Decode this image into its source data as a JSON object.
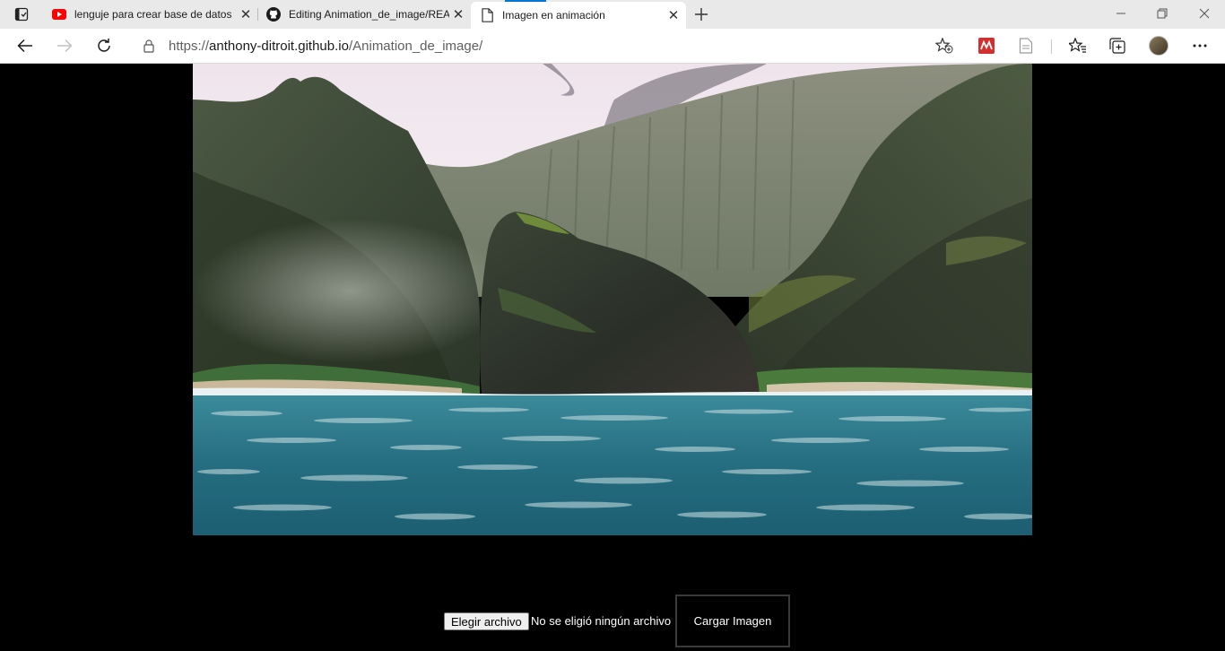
{
  "browser": {
    "tabs": [
      {
        "title": "lenguje para crear base de datos",
        "icon": "youtube-icon"
      },
      {
        "title": "Editing Animation_de_image/README",
        "icon": "github-icon"
      },
      {
        "title": "Imagen en animación",
        "icon": "page-icon",
        "active": true
      }
    ],
    "url_scheme": "https://",
    "url_host": "anthony-ditroit.github.io",
    "url_path": "/Animation_de_image/"
  },
  "page": {
    "image_alt": "Imagen en animación",
    "file_input": {
      "button_label": "Elegir archivo",
      "status": "No se eligió ningún archivo"
    },
    "load_button_label": "Cargar Imagen"
  },
  "colors": {
    "page_background": "#000000",
    "accent": "#0078d4",
    "extension_red": "#d32f2f"
  }
}
